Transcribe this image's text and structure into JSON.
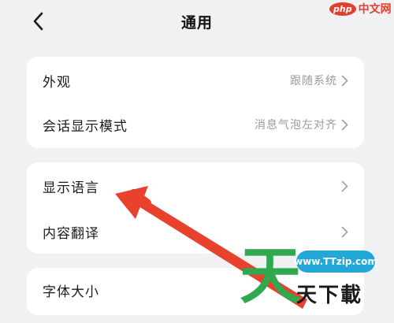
{
  "header": {
    "title": "通用",
    "back_icon": "chevron-left-icon"
  },
  "watermark_top": {
    "logo": "php",
    "text": "中文网"
  },
  "groups": [
    {
      "rows": [
        {
          "label": "外观",
          "value": "跟随系统"
        },
        {
          "label": "会话显示模式",
          "value": "消息气泡左对齐"
        }
      ]
    },
    {
      "rows": [
        {
          "label": "显示语言",
          "value": ""
        },
        {
          "label": "内容翻译",
          "value": ""
        }
      ]
    },
    {
      "rows": [
        {
          "label": "字体大小",
          "value": ""
        }
      ]
    }
  ],
  "annotation": {
    "arrow_color": "#e8412e"
  },
  "watermark_bottom": {
    "url": "www.TTzip.com",
    "big_char": "天",
    "text": "天下載"
  },
  "colors": {
    "background": "#f1f1f3",
    "card": "#ffffff",
    "secondary_text": "#9a9a9e"
  }
}
